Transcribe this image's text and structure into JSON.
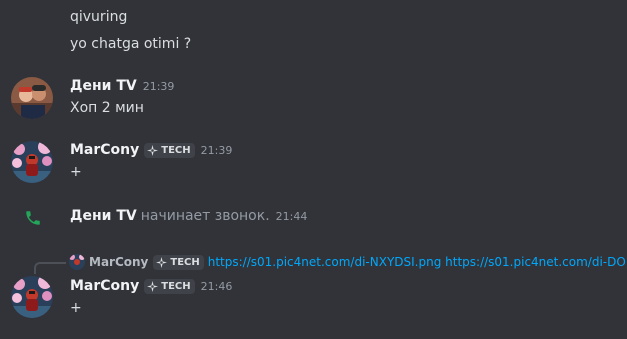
{
  "lines": {
    "first": "qivuring",
    "second": "yo chatga otimi  ?"
  },
  "messages": [
    {
      "username": "Дени TV",
      "timestamp": "21:39",
      "content": "Хоп 2 мин"
    },
    {
      "username": "MarCony",
      "tag": "TECH",
      "timestamp": "21:39",
      "content": "+"
    },
    {
      "username": "MarCony",
      "tag": "TECH",
      "timestamp": "21:46",
      "content": "+"
    }
  ],
  "call": {
    "username": "Дени TV",
    "text": "начинает звонок.",
    "timestamp": "21:44"
  },
  "reply": {
    "username": "MarCony",
    "tag": "TECH",
    "text": "https://s01.pic4net.com/di-NXYDSI.png https://s01.pic4net.com/di-DO"
  },
  "colors": {
    "background": "#313338",
    "link": "#00a8fc",
    "call_green": "#23a55a",
    "muted": "#949ba4"
  },
  "icons": {
    "call": "phone-icon",
    "tag": "sparkle-icon"
  }
}
